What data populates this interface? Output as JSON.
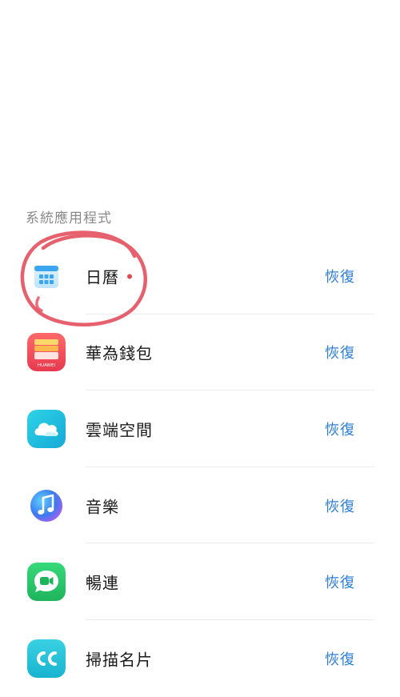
{
  "section": {
    "title": "系統應用程式"
  },
  "apps": [
    {
      "name": "日曆",
      "icon": "calendar-icon",
      "action": "恢復",
      "has_dot": true
    },
    {
      "name": "華為錢包",
      "icon": "wallet-icon",
      "action": "恢復",
      "brand": "HUAWEI"
    },
    {
      "name": "雲端空間",
      "icon": "cloud-icon",
      "action": "恢復"
    },
    {
      "name": "音樂",
      "icon": "music-icon",
      "action": "恢復"
    },
    {
      "name": "暢連",
      "icon": "meetime-icon",
      "action": "恢復"
    },
    {
      "name": "掃描名片",
      "icon": "card-scanner-icon",
      "action": "恢復"
    }
  ],
  "colors": {
    "accent": "#2f7ed8",
    "annotation": "#e24a5a",
    "dot": "#e5484d"
  }
}
